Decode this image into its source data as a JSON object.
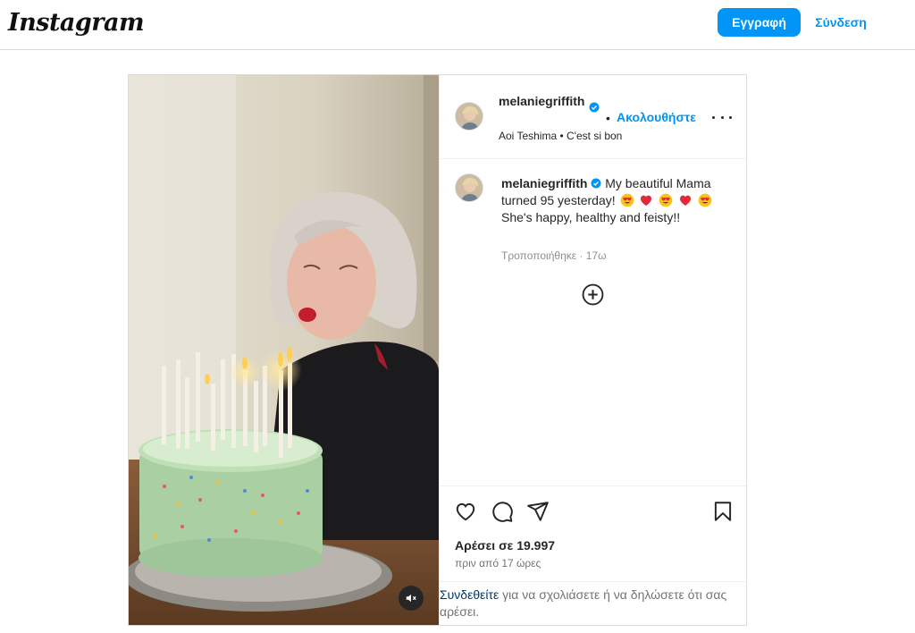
{
  "header": {
    "logo_text": "Instagram",
    "signup_label": "Εγγραφή",
    "login_label": "Σύνδεση"
  },
  "post": {
    "username": "melaniegriffith",
    "follow_label": "Ακολουθήστε",
    "separator": "•",
    "audio": "Aoi Teshima • C'est si bon",
    "caption_part1": "My beautiful Mama turned 95 yesterday!",
    "caption_part2": "She's happy, healthy and feisty!!",
    "edited_meta": "Τροποποιήθηκε · 17ω",
    "likes": "Αρέσει σε 19.997",
    "time_ago": "πριν από 17 ώρες",
    "login_link": "Συνδεθείτε",
    "login_prompt": " για να σχολιάσετε ή να δηλώσετε ότι σας αρέσει."
  },
  "icons": {
    "verified": "verified-badge-icon",
    "more": "more-options-icon",
    "add_comment": "plus-circle-icon",
    "like": "heart-icon",
    "comment": "comment-icon",
    "share": "share-icon",
    "save": "bookmark-icon",
    "mute": "muted-speaker-icon",
    "emojis": [
      "smiling-face-with-heart-eyes",
      "red-heart",
      "smiling-face-with-heart-eyes",
      "red-heart",
      "smiling-face-with-heart-eyes"
    ]
  },
  "colors": {
    "accent": "#0095f6",
    "text": "#262626",
    "muted": "#737373",
    "border": "#dbdbdb",
    "link_dark": "#00376b"
  }
}
